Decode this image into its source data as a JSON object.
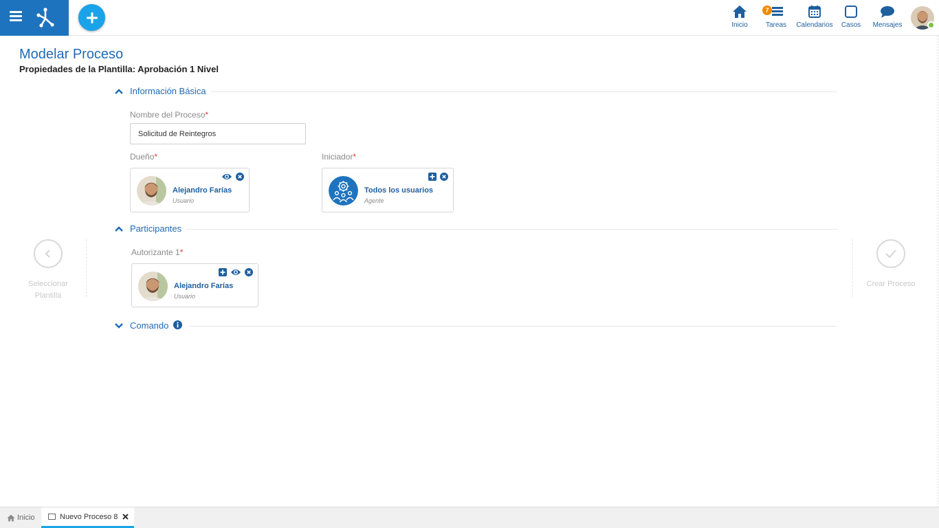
{
  "header": {
    "nav": [
      {
        "label": "Inicio"
      },
      {
        "label": "Tareas",
        "badge": "7"
      },
      {
        "label": "Calendarios"
      },
      {
        "label": "Casos"
      },
      {
        "label": "Mensajes"
      }
    ]
  },
  "page": {
    "title": "Modelar Proceso",
    "subtitle": "Propiedades de la Plantilla: Aprobación 1 Nivel"
  },
  "sections": {
    "basic": {
      "title": "Información Básica",
      "process_name_label": "Nombre del Proceso",
      "process_name_value": "Solicitud de Reintegros",
      "owner_label": "Dueño",
      "initiator_label": "Iniciador",
      "owner": {
        "name": "Alejandro Farías",
        "type": "Usuario"
      },
      "initiator": {
        "name": "Todos los usuarios",
        "type": "Agente"
      }
    },
    "participants": {
      "title": "Participantes",
      "approver_label": "Autorizante 1",
      "approver": {
        "name": "Alejandro Farías",
        "type": "Usuario"
      }
    },
    "command": {
      "title": "Comando"
    }
  },
  "required_mark": "*",
  "side_nav": {
    "prev_label_line1": "Seleccionar",
    "prev_label_line2": "Plantilla",
    "next_label": "Crear Proceso"
  },
  "tabs": [
    {
      "label": "Inicio"
    },
    {
      "label": "Nuevo Proceso 8"
    }
  ],
  "colors": {
    "brand_blue": "#1e73be",
    "accent_cyan": "#1aa3e8",
    "link_blue": "#1e6bb8",
    "badge_orange": "#f08a00",
    "online_green": "#7dc242"
  }
}
